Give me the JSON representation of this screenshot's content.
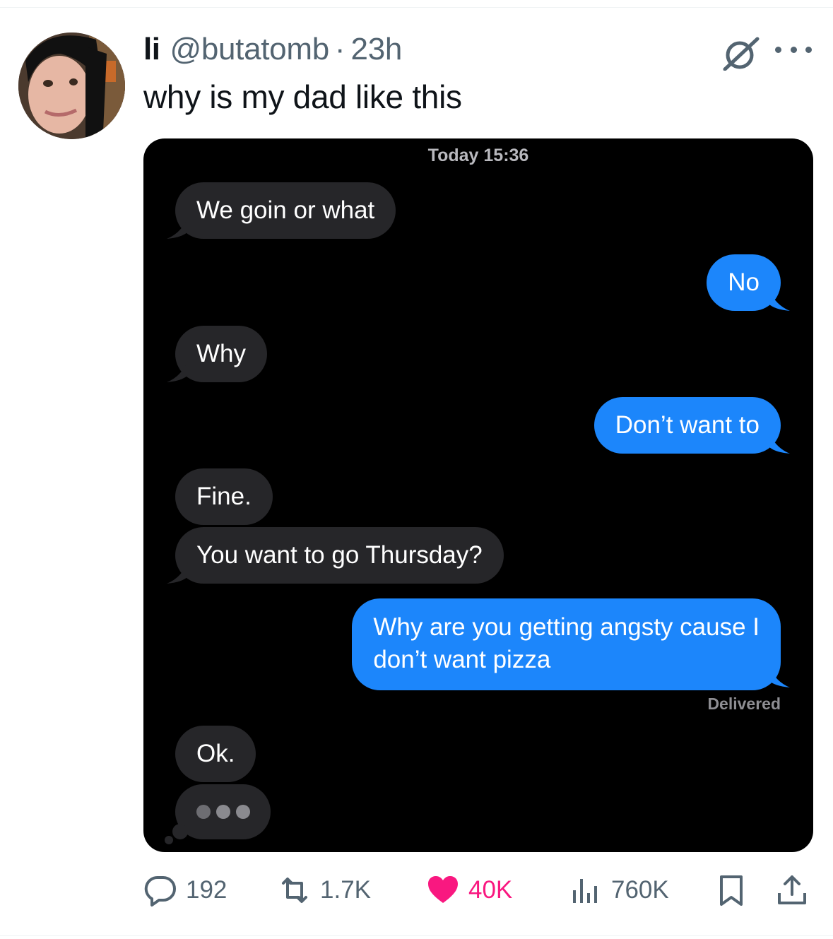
{
  "tweet": {
    "display_name": "li",
    "handle": "@butatomb",
    "separator": "·",
    "time": "23h",
    "text": "why is my dad like this"
  },
  "conversation": {
    "timestamp": "Today 15:36",
    "messages": [
      {
        "from": "them",
        "text": "We goin or what"
      },
      {
        "from": "me",
        "text": "No"
      },
      {
        "from": "them",
        "text": "Why"
      },
      {
        "from": "me",
        "text": "Don’t want to"
      },
      {
        "from": "them",
        "text": "Fine."
      },
      {
        "from": "them",
        "text": "You want to go Thursday?"
      },
      {
        "from": "me",
        "text_line1": "Why are you getting angsty cause I",
        "text_line2": "don’t want pizza"
      },
      {
        "from": "them",
        "text": "Ok."
      }
    ],
    "status": "Delivered"
  },
  "actions": {
    "replies": "192",
    "reposts": "1.7K",
    "likes": "40K",
    "views": "760K"
  },
  "colors": {
    "accent_blue": "#1c86fb",
    "incoming_bubble": "#262629",
    "like_pink": "#f91880",
    "secondary_text": "#536471"
  },
  "icons": [
    "grok-icon",
    "more-icon",
    "reply-icon",
    "repost-icon",
    "like-icon",
    "views-icon",
    "bookmark-icon",
    "share-icon"
  ]
}
